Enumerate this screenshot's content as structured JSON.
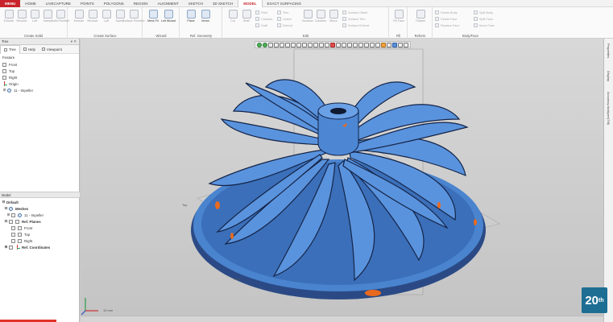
{
  "menu": {
    "file": "MENU",
    "items": [
      "HOME",
      "LIVECAPTURE",
      "POINTS",
      "POLYGONS",
      "REGION",
      "ALIGNMENT",
      "SKETCH",
      "3D SKETCH",
      "MODEL",
      "EXACT SURFACING"
    ],
    "active": "MODEL"
  },
  "ribbon": {
    "groups": [
      "Create Solid",
      "Create Surface",
      "Wizard",
      "Ref. Geometry",
      "Edit",
      "Fill",
      "Reform",
      "Body/Face"
    ],
    "create_solid": [
      "Extrude",
      "Revolve",
      "Loft",
      "Sweep",
      "Solid Primitive"
    ],
    "create_surface": [
      "Extrude",
      "Revolve",
      "Loft",
      "Sweep",
      "Surface Primitive"
    ],
    "wizard": [
      "Mesh Fit",
      "Loft Wizard"
    ],
    "ref_geometry": [
      "Plane",
      "Vector"
    ],
    "edit_large": [
      "Cut",
      "Shell"
    ],
    "edit_small": [
      "Fillet",
      "Chamfer",
      "Draft",
      "Trim",
      "Untrim",
      "Extend",
      "Surface Offset",
      "Surface Trim",
      "Surface Extend"
    ],
    "edit_buttons": [
      "Boolean",
      "Combine",
      "Mirror"
    ],
    "fill_buttons": [
      "Fill Face"
    ],
    "reform_buttons": [
      "Thicken"
    ],
    "body_face": [
      "Delete Body",
      "Delete Face",
      "Replace Face",
      "Split Body",
      "Split Face",
      "Move Face"
    ]
  },
  "left_panel": {
    "title": "Tree",
    "tabs": [
      "Tree",
      "Help",
      "Viewpoint"
    ],
    "feature_header": "Feature",
    "feature_items": [
      "Front",
      "Top",
      "Right",
      "Origin",
      "11 - Impeller"
    ],
    "model_title": "Model",
    "model_root": "Default",
    "mesh_group": "Meshes",
    "mesh_item": "11 - Impeller",
    "ref_planes": "Ref. Planes",
    "ref_plane_items": [
      "Front",
      "Top",
      "Right"
    ],
    "ref_coords": "Ref. Coordinates"
  },
  "viewport": {
    "view_label_left": "Top",
    "view_label_bottom": "Front",
    "scale_label": "10 mm",
    "colors": {
      "mesh": "#3d79c7",
      "mesh_dark": "#16254a",
      "deviation": "#e96a1e"
    }
  },
  "right_panel": {
    "labels": [
      "Properties",
      "Display",
      "Accuracy Analyzer(TM)"
    ]
  },
  "logo": {
    "text": "20",
    "sup": "th"
  },
  "icons": [
    "pointer-icon",
    "rotate-icon",
    "zoom-icon",
    "pan-icon",
    "fit-icon",
    "view-cube-icon"
  ]
}
